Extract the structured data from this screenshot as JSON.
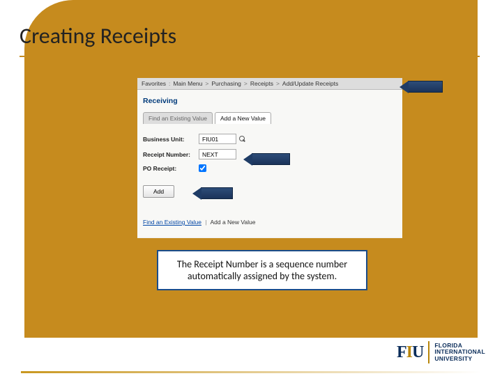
{
  "slide": {
    "title": "Creating Receipts"
  },
  "breadcrumb": {
    "i0": "Favorites",
    "i1": "Main Menu",
    "i2": "Purchasing",
    "i3": "Receipts",
    "i4": "Add/Update Receipts"
  },
  "page": {
    "heading": "Receiving"
  },
  "tabs": {
    "find": "Find an Existing Value",
    "add": "Add a New Value"
  },
  "form": {
    "business_unit_label": "Business Unit:",
    "business_unit_value": "FIU01",
    "receipt_number_label": "Receipt Number:",
    "receipt_number_value": "NEXT",
    "po_receipt_label": "PO Receipt:"
  },
  "buttons": {
    "add": "Add"
  },
  "bottom_links": {
    "find": "Find an Existing Value",
    "add": "Add a New Value"
  },
  "caption": "The Receipt Number is a sequence number automatically assigned by the system.",
  "logo": {
    "line1": "FLORIDA",
    "line2": "INTERNATIONAL",
    "line3": "UNIVERSITY"
  }
}
